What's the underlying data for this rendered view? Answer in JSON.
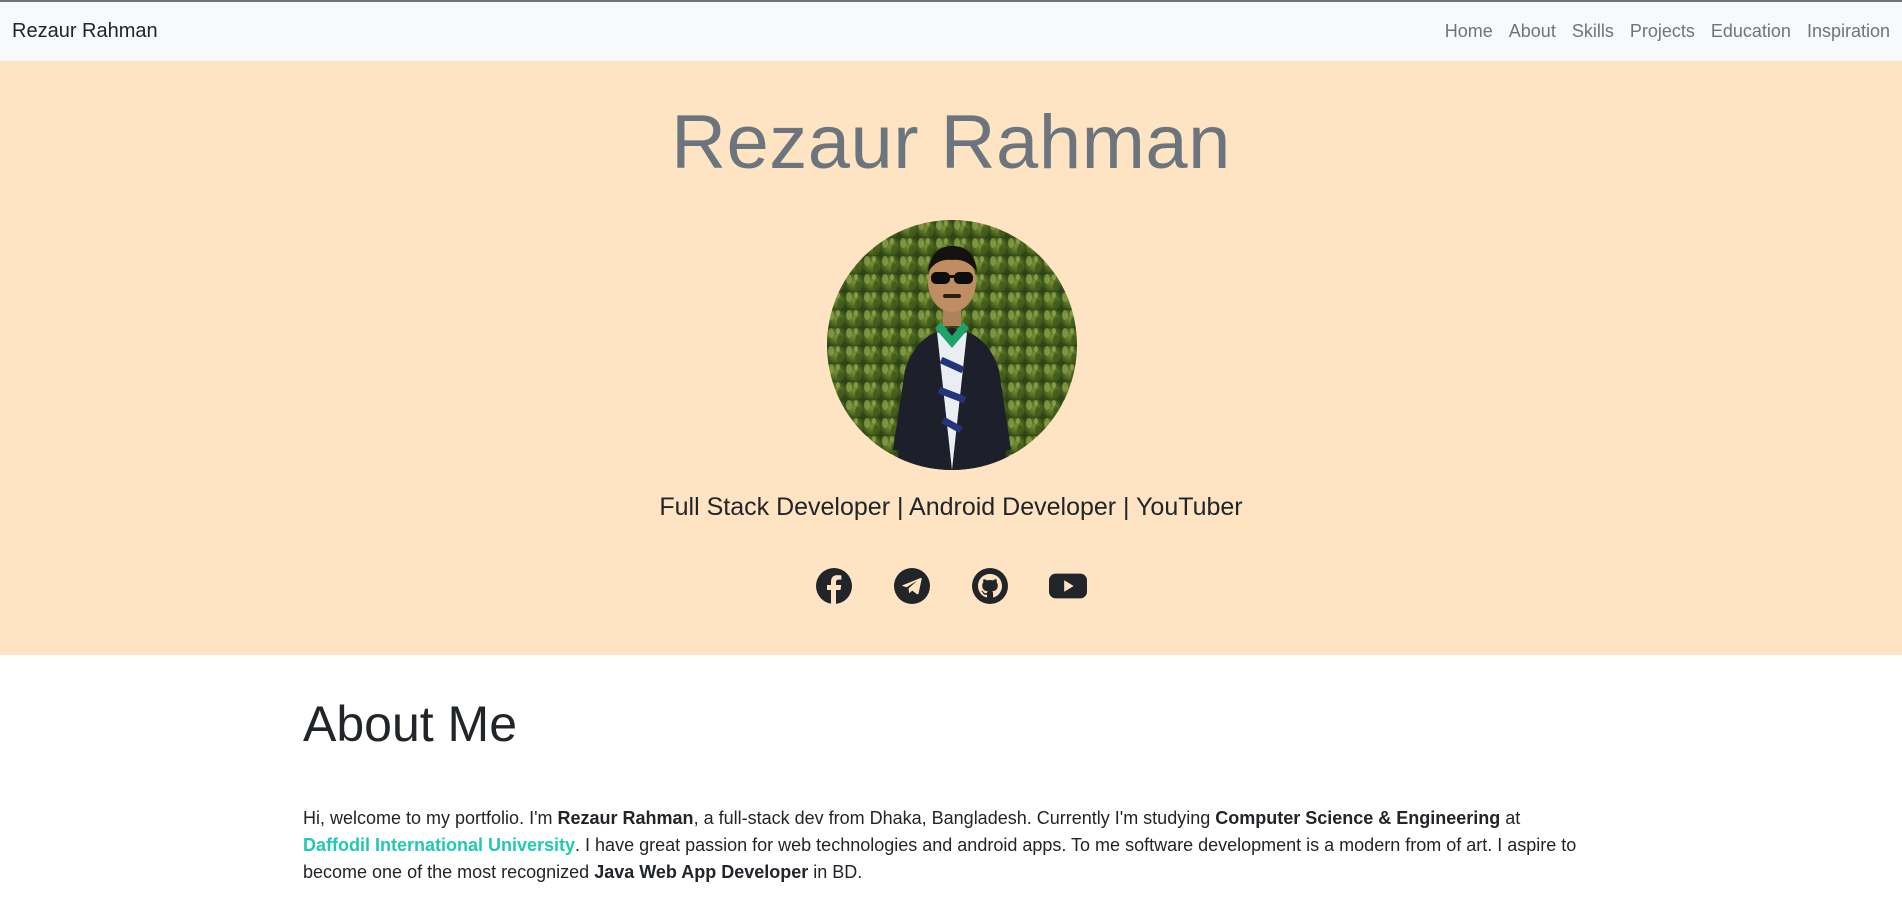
{
  "navbar": {
    "brand": "Rezaur Rahman",
    "links": [
      "Home",
      "About",
      "Skills",
      "Projects",
      "Education",
      "Inspiration"
    ]
  },
  "hero": {
    "title": "Rezaur Rahman",
    "tagline": "Full Stack Developer | Android Developer | YouTuber",
    "socials": [
      "facebook-icon",
      "telegram-icon",
      "github-icon",
      "youtube-icon"
    ],
    "background_color": "#ffe4c4"
  },
  "about": {
    "title": "About Me",
    "p1": "Hi, welcome to my portfolio. I'm ",
    "name": "Rezaur Rahman",
    "p2": ", a full-stack dev from Dhaka, Bangladesh. Currently I'm studying ",
    "subject": "Computer Science & Engineering",
    "p3": " at ",
    "university": "Daffodil International University",
    "p4": ". I have great passion for web technologies and android apps. To me software development is a modern from of art. I aspire to become one of the most recognized ",
    "role": "Java Web App Developer",
    "p5": " in BD."
  },
  "colors": {
    "accent": "#20c9b1",
    "muted": "#6c757d",
    "text": "#212529"
  }
}
